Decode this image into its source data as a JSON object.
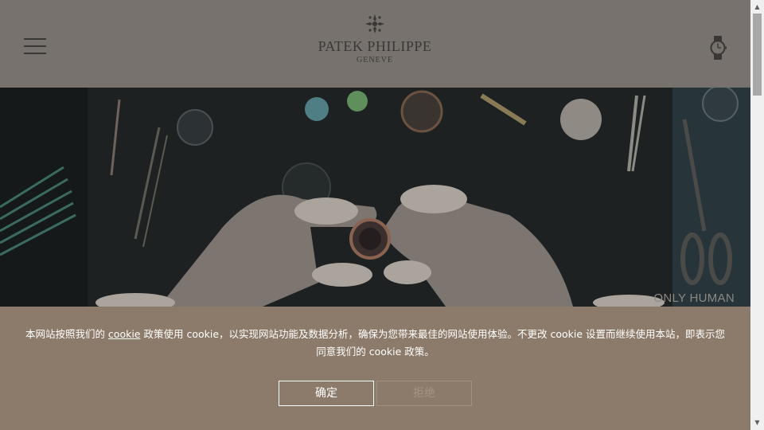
{
  "header": {
    "brand": "PATEK PHILIPPE",
    "city": "GENEVE",
    "menu_icon": "hamburger-menu-icon",
    "watch_icon": "watch-icon"
  },
  "hero": {
    "caption": "ONLY HUMAN"
  },
  "cookie_banner": {
    "text_before_link": "本网站按照我们的 ",
    "link_text": "cookie",
    "text_after_link": " 政策使用 cookie，以实现网站功能及数据分析，确保为您带来最佳的网站使用体验。不更改 cookie 设置而继续使用本站，即表示您同意我们的 cookie 政策。",
    "accept_label": "确定",
    "reject_label": "拒绝"
  },
  "scrollbar": {
    "up_glyph": "▲",
    "down_glyph": "▼"
  },
  "colors": {
    "header_bg": "#77726d",
    "banner_bg": "#8c7b6a",
    "hero_bg": "#1f2223"
  }
}
